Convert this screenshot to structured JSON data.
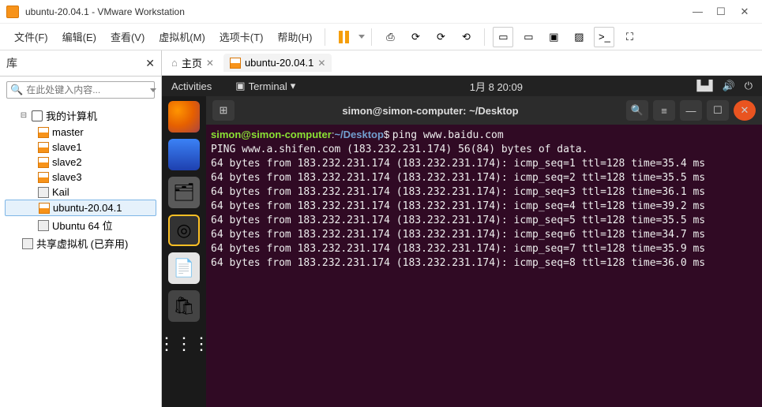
{
  "window": {
    "title": "ubuntu-20.04.1 - VMware Workstation"
  },
  "menus": {
    "file": "文件(F)",
    "edit": "编辑(E)",
    "view": "查看(V)",
    "vm": "虚拟机(M)",
    "tabs": "选项卡(T)",
    "help": "帮助(H)"
  },
  "library": {
    "title": "库",
    "search_placeholder": "在此处键入内容...",
    "root": "我的计算机",
    "items": [
      "master",
      "slave1",
      "slave2",
      "slave3",
      "Kail",
      "ubuntu-20.04.1",
      "Ubuntu 64 位"
    ],
    "shared": "共享虚拟机 (已弃用)"
  },
  "tabs": {
    "home": "主页",
    "vm": "ubuntu-20.04.1"
  },
  "gnome": {
    "activities": "Activities",
    "app": "Terminal",
    "clock": "1月 8  20:09"
  },
  "terminal": {
    "title": "simon@simon-computer: ~/Desktop",
    "prompt_user": "simon@simon-computer",
    "prompt_path": "~/Desktop",
    "command": "ping www.baidu.com",
    "lines": [
      "PING www.a.shifen.com (183.232.231.174) 56(84) bytes of data.",
      "64 bytes from 183.232.231.174 (183.232.231.174): icmp_seq=1 ttl=128 time=35.4 ms",
      "64 bytes from 183.232.231.174 (183.232.231.174): icmp_seq=2 ttl=128 time=35.5 ms",
      "64 bytes from 183.232.231.174 (183.232.231.174): icmp_seq=3 ttl=128 time=36.1 ms",
      "64 bytes from 183.232.231.174 (183.232.231.174): icmp_seq=4 ttl=128 time=39.2 ms",
      "64 bytes from 183.232.231.174 (183.232.231.174): icmp_seq=5 ttl=128 time=35.5 ms",
      "64 bytes from 183.232.231.174 (183.232.231.174): icmp_seq=6 ttl=128 time=34.7 ms",
      "64 bytes from 183.232.231.174 (183.232.231.174): icmp_seq=7 ttl=128 time=35.9 ms",
      "64 bytes from 183.232.231.174 (183.232.231.174): icmp_seq=8 ttl=128 time=36.0 ms"
    ]
  }
}
